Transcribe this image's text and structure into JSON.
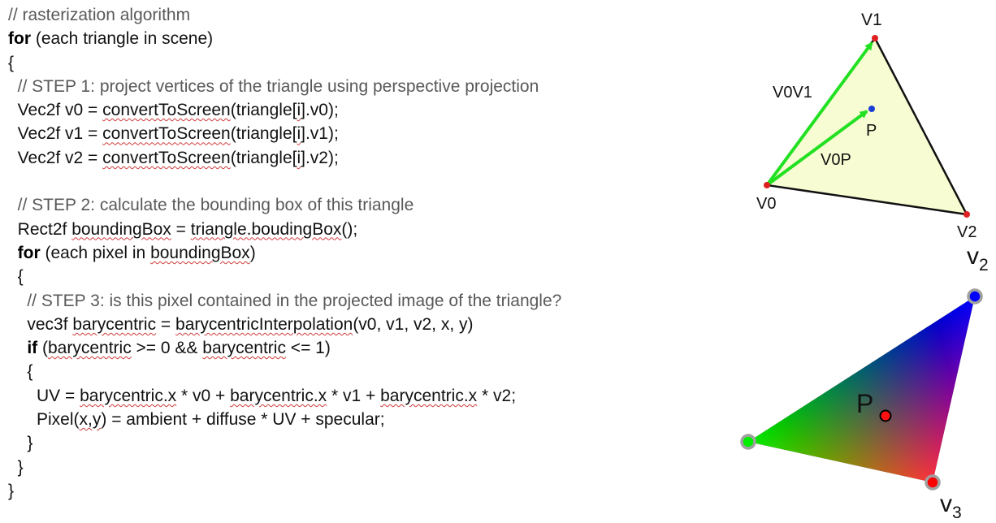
{
  "code": [
    [
      {
        "t": "// rasterization algorithm",
        "c": "cm"
      }
    ],
    [
      {
        "t": "for",
        "c": "kw"
      },
      {
        "t": " (each triangle in scene)"
      }
    ],
    [
      {
        "t": "{"
      }
    ],
    [
      {
        "t": "  // STEP 1: project vertices of the triangle using perspective projection",
        "c": "cm"
      }
    ],
    [
      {
        "t": "  Vec2f v0 = "
      },
      {
        "t": "convertToScreen",
        "c": "sq"
      },
      {
        "t": "(triangle["
      },
      {
        "t": "i",
        "c": "sq"
      },
      {
        "t": "].v0);"
      }
    ],
    [
      {
        "t": "  Vec2f v1 = "
      },
      {
        "t": "convertToScreen",
        "c": "sq"
      },
      {
        "t": "(triangle["
      },
      {
        "t": "i",
        "c": "sq"
      },
      {
        "t": "].v1);"
      }
    ],
    [
      {
        "t": "  Vec2f v2 = "
      },
      {
        "t": "convertToScreen",
        "c": "sq"
      },
      {
        "t": "(triangle["
      },
      {
        "t": "i",
        "c": "sq"
      },
      {
        "t": "].v2);"
      }
    ],
    [
      {
        "t": ""
      }
    ],
    [
      {
        "t": "  // STEP 2: calculate the bounding box of this triangle",
        "c": "cm"
      }
    ],
    [
      {
        "t": "  Rect2f "
      },
      {
        "t": "boundingBox",
        "c": "sq"
      },
      {
        "t": " = "
      },
      {
        "t": "triangle.boudingBox",
        "c": "sq"
      },
      {
        "t": "();"
      }
    ],
    [
      {
        "t": "  "
      },
      {
        "t": "for",
        "c": "kw"
      },
      {
        "t": " (each pixel in "
      },
      {
        "t": "boundingBox",
        "c": "sq"
      },
      {
        "t": ")"
      }
    ],
    [
      {
        "t": "  {"
      }
    ],
    [
      {
        "t": "    // STEP 3: is this pixel contained in the projected image of the triangle?",
        "c": "cm"
      }
    ],
    [
      {
        "t": "    vec3f "
      },
      {
        "t": "barycentric",
        "c": "sq"
      },
      {
        "t": " = "
      },
      {
        "t": "barycentricInterpolation",
        "c": "sq"
      },
      {
        "t": "(v0, v1, v2, x, y)"
      }
    ],
    [
      {
        "t": "    "
      },
      {
        "t": "if",
        "c": "kw"
      },
      {
        "t": " ("
      },
      {
        "t": "barycentric",
        "c": "sq"
      },
      {
        "t": " >= 0 && "
      },
      {
        "t": "barycentric",
        "c": "sq"
      },
      {
        "t": " <= 1)"
      }
    ],
    [
      {
        "t": "    {"
      }
    ],
    [
      {
        "t": "      UV = "
      },
      {
        "t": "barycentric.x",
        "c": "sq"
      },
      {
        "t": " * v0 + "
      },
      {
        "t": "barycentric.x",
        "c": "sq"
      },
      {
        "t": " * v1 + "
      },
      {
        "t": "barycentric.x",
        "c": "sq"
      },
      {
        "t": " * v2;"
      }
    ],
    [
      {
        "t": "      Pixel("
      },
      {
        "t": "x,y",
        "c": "sq"
      },
      {
        "t": ") = ambient + diffuse * UV + specular;"
      }
    ],
    [
      {
        "t": "    }"
      }
    ],
    [
      {
        "t": "  }"
      }
    ],
    [
      {
        "t": "}"
      }
    ]
  ],
  "top_diagram": {
    "v1": "V1",
    "v0": "V0",
    "v2": "V2",
    "edge_v0v1": "V0V1",
    "edge_v0p": "V0P",
    "p": "P",
    "colors": {
      "fill": "#f8fcd2",
      "vector": "#22e022",
      "vertex": "#e02020",
      "point": "#1a3fd6"
    }
  },
  "bottom_diagram": {
    "v2": "v",
    "v2_sub": "2",
    "v3": "v",
    "v3_sub": "3",
    "p": "P",
    "colors": {
      "blue": "#0000ff",
      "green": "#00ee00",
      "red": "#ff0000",
      "ring": "#a0a0a0"
    }
  }
}
